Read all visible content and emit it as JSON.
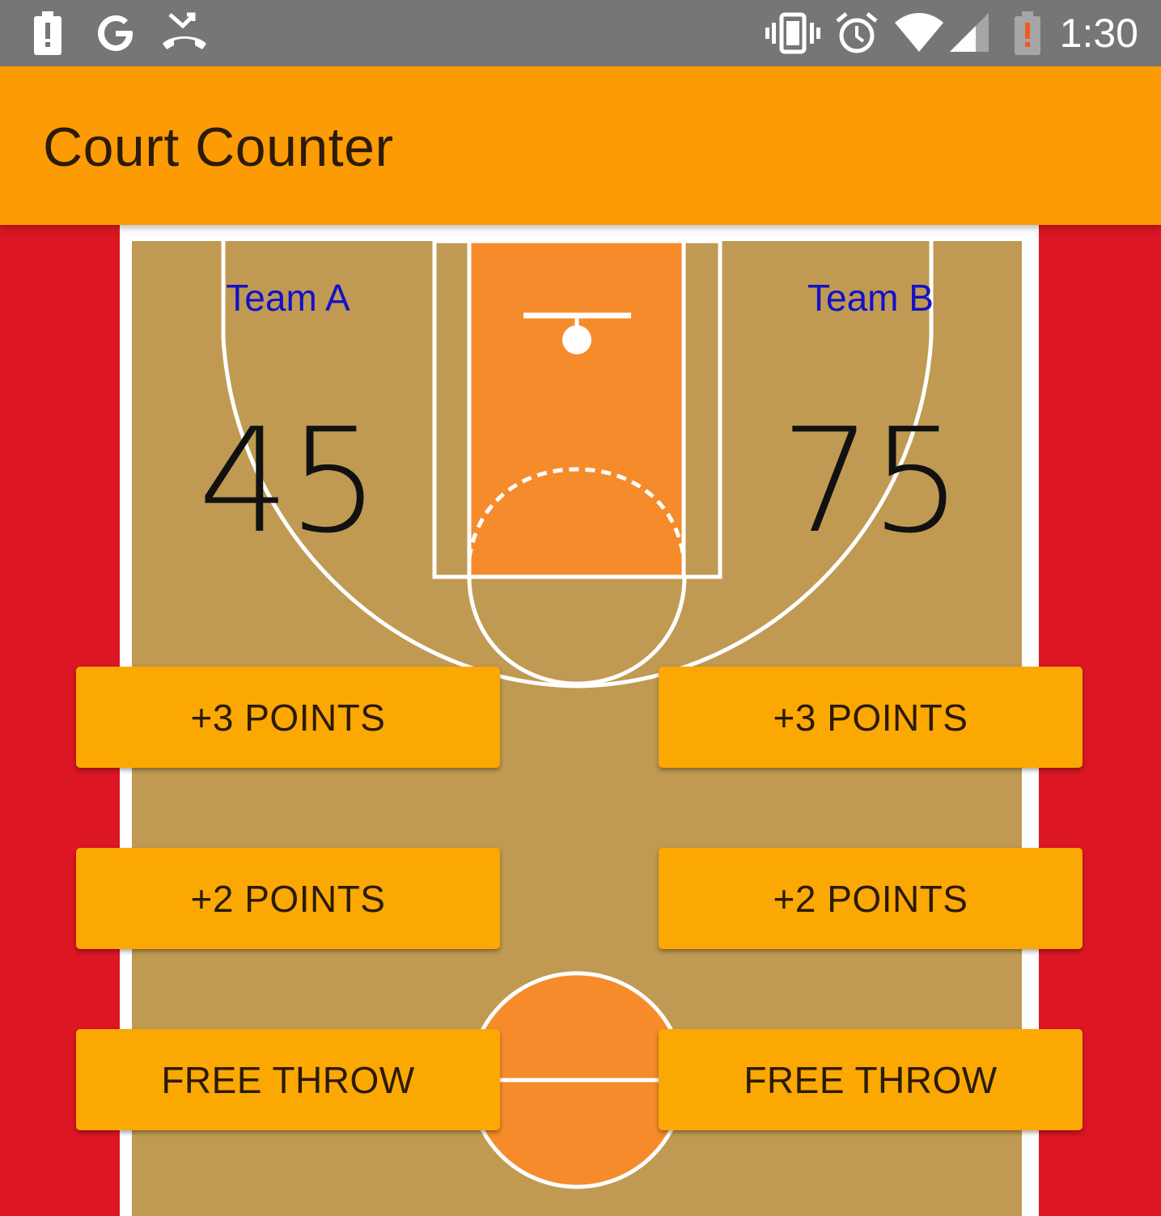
{
  "status_bar": {
    "time": "1:30",
    "left_icons": [
      "battery-alert-icon",
      "google-icon",
      "missed-call-icon"
    ],
    "right_icons": [
      "vibrate-icon",
      "alarm-icon",
      "wifi-icon",
      "signal-icon",
      "battery-low-icon"
    ]
  },
  "app_bar": {
    "title": "Court Counter",
    "color": "#fc9b03"
  },
  "teams": [
    {
      "name": "Team A",
      "score": "45"
    },
    {
      "name": "Team B",
      "score": "75"
    }
  ],
  "buttons": {
    "three_points": "+3 POINTS",
    "two_points": "+2 POINTS",
    "free_throw": "FREE THROW"
  },
  "colors": {
    "background": "#dc1623",
    "court_wood": "#c09a52",
    "paint": "#f68b2b",
    "button": "#fca802",
    "team_label": "#1212c8"
  }
}
